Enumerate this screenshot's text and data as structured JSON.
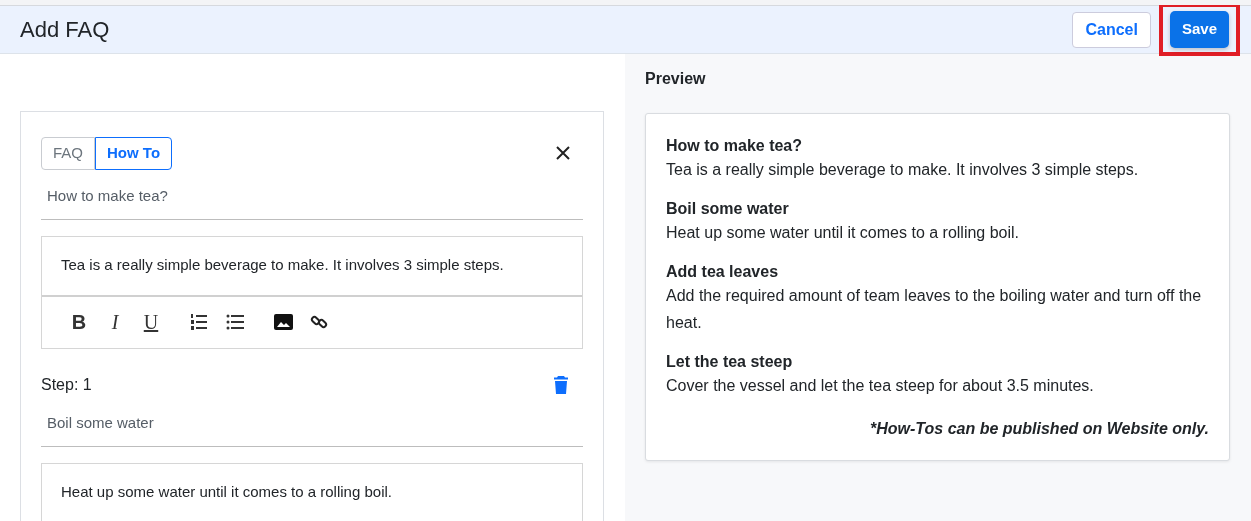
{
  "header": {
    "title": "Add FAQ",
    "buttons": [
      {
        "label": "Cancel",
        "kind": "outline",
        "highlighted": false
      },
      {
        "label": "Save",
        "kind": "primary",
        "highlighted": true
      }
    ]
  },
  "editor": {
    "type_tabs": [
      {
        "label": "FAQ",
        "selected": false
      },
      {
        "label": "How To",
        "selected": true
      }
    ],
    "question": {
      "value": "How to make tea?"
    },
    "answer": {
      "value": "Tea is a really simple beverage to make. It involves 3 simple steps."
    },
    "toolbar": [
      {
        "kind": "bold",
        "label": "B"
      },
      {
        "kind": "italic",
        "label": "I"
      },
      {
        "kind": "underline",
        "label": "U"
      },
      {
        "kind": "ordered-list"
      },
      {
        "kind": "bullet-list"
      },
      {
        "kind": "image"
      },
      {
        "kind": "link"
      }
    ],
    "steps": [
      {
        "label": "Step: 1",
        "title": "Boil some water",
        "body": "Heat up some water until it comes to a rolling boil."
      }
    ]
  },
  "preview": {
    "title": "Preview",
    "items": [
      {
        "heading": "How to make tea?",
        "text": "Tea is a really simple beverage to make. It involves 3 simple steps."
      },
      {
        "heading": "Boil some water",
        "text": "Heat up some water until it comes to a rolling boil."
      },
      {
        "heading": "Add tea leaves",
        "text": "Add the required amount of team leaves to the boiling water and turn off the heat."
      },
      {
        "heading": "Let the tea steep",
        "text": "Cover the vessel and let the tea steep for about 3.5 minutes."
      }
    ],
    "note": "*How-Tos can be published on Website only."
  }
}
